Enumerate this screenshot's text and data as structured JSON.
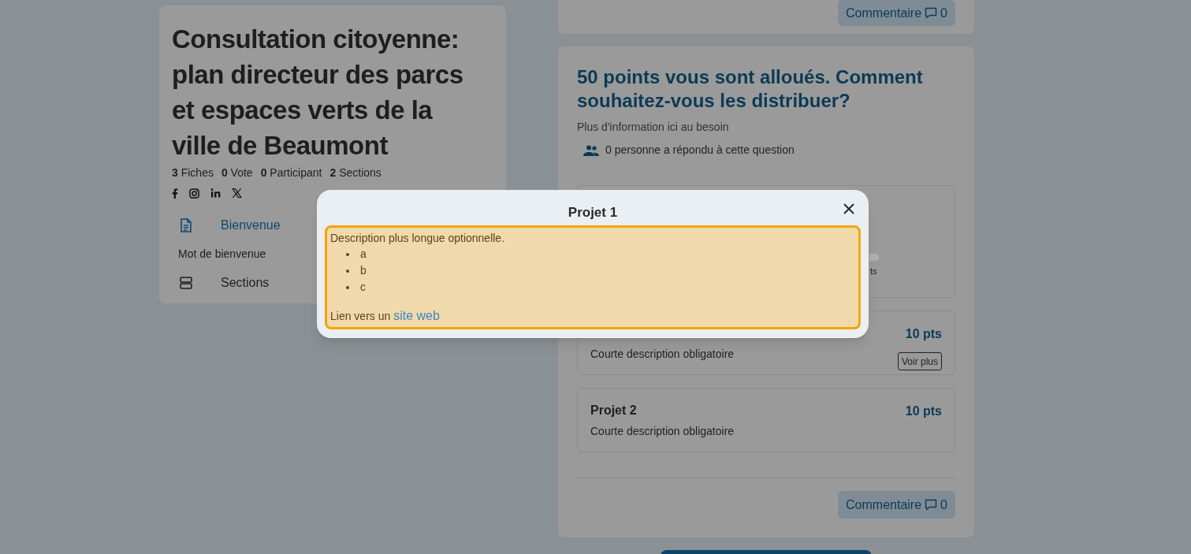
{
  "survey": {
    "title": "Consultation citoyenne: plan directeur des parcs et espaces verts de la ville de Beaumont",
    "stats": [
      "**3** Fiches",
      "**0** Vote",
      "**0** Participant",
      "**2** Sections"
    ],
    "nav": [
      {
        "kind": "page",
        "label": "Bienvenue",
        "selected": true
      },
      {
        "kind": "subitem",
        "label": "Mot de bienvenue",
        "selected": false
      },
      {
        "kind": "sections",
        "label": "Sections",
        "selected": false
      }
    ]
  },
  "previous_card": {
    "comment_button": {
      "label": "Commentaire",
      "count": "0"
    }
  },
  "question": {
    "title": "50 points vous sont alloués. Comment souhaitez-vous les distribuer?",
    "info": "Plus d'information ici au besoin",
    "respondents": "0 personne a répondu à cette question",
    "partial_label": "ts",
    "projects": [
      {
        "points": "10 pts",
        "description": "Courte description obligatoire",
        "more_button": "Voir plus"
      },
      {
        "title": "Projet 2",
        "points": "10 pts",
        "description": "Courte description obligatoire"
      }
    ],
    "comment_button": {
      "label": "Commentaire",
      "count": "0"
    }
  },
  "modal": {
    "title": "Projet 1",
    "description": "Description plus longue optionnelle.",
    "bullets": [
      "a",
      "b",
      "c"
    ],
    "link_prefix": "Lien vers un",
    "link_text": "site web"
  }
}
